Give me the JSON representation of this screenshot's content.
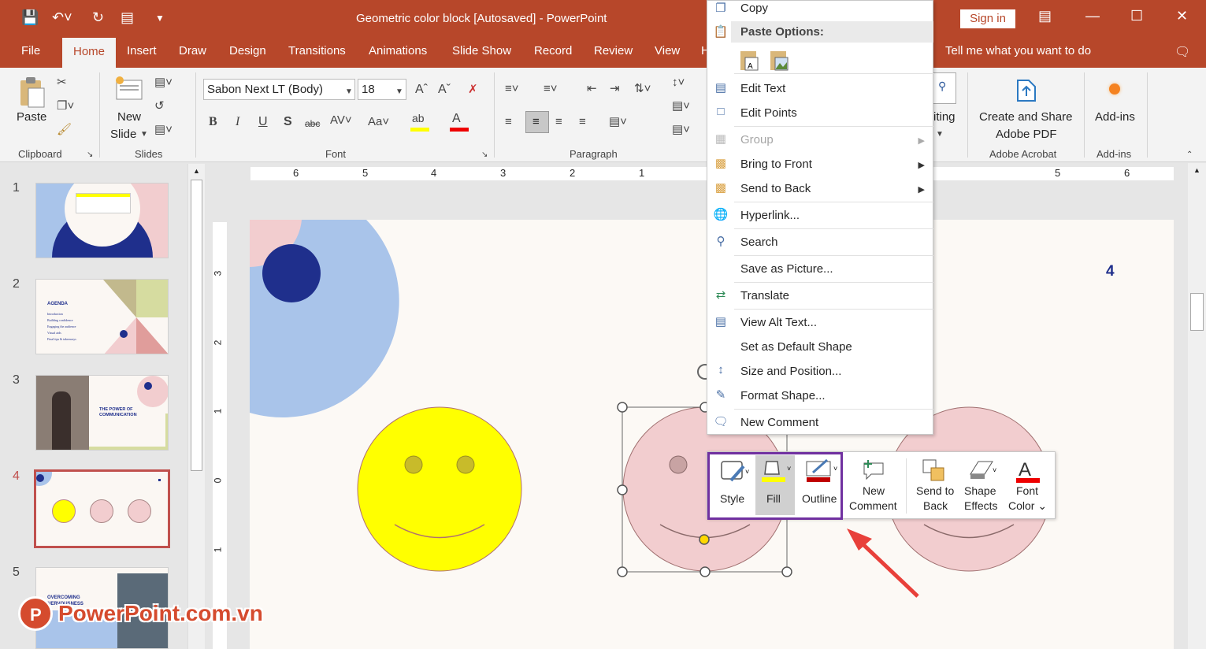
{
  "app": {
    "title": "Geometric color block [Autosaved]  -  PowerPoint",
    "sign_in": "Sign in",
    "tell_me": "Tell me what you want to do"
  },
  "tabs": [
    "File",
    "Home",
    "Insert",
    "Draw",
    "Design",
    "Transitions",
    "Animations",
    "Slide Show",
    "Record",
    "Review",
    "View",
    "H"
  ],
  "ribbon": {
    "clipboard": {
      "paste": "Paste",
      "label": "Clipboard"
    },
    "slides": {
      "new": "New",
      "slide": "Slide",
      "label": "Slides"
    },
    "font": {
      "name": "Sabon Next LT (Body)",
      "size": "18",
      "label": "Font"
    },
    "paragraph": {
      "label": "Paragraph"
    },
    "editing_partial": "iting",
    "acrobat": {
      "line1": "Create and Share",
      "line2": "Adobe PDF",
      "label": "Adobe Acrobat"
    },
    "addins": {
      "btn": "Add-ins",
      "label": "Add-ins"
    }
  },
  "slides": [
    {
      "num": "1"
    },
    {
      "num": "2",
      "heading": "AGENDA",
      "items": [
        "Introduction",
        "Building confidence",
        "Engaging the audience",
        "Visual aids",
        "Final tips & takeaways"
      ]
    },
    {
      "num": "3",
      "heading": "THE POWER OF COMMUNICATION"
    },
    {
      "num": "4"
    },
    {
      "num": "5",
      "heading": "OVERCOMING NERVOUSNESS"
    }
  ],
  "ruler": {
    "h": [
      "6",
      "5",
      "4",
      "3",
      "2",
      "1",
      "5",
      "6"
    ],
    "v": [
      "3",
      "2",
      "1",
      "0",
      "1"
    ]
  },
  "slide_number": "4",
  "context_menu": {
    "copy": "Copy",
    "paste_options": "Paste Options:",
    "edit_text": "Edit Text",
    "edit_points": "Edit Points",
    "group": "Group",
    "bring_front": "Bring to Front",
    "send_back": "Send to Back",
    "hyperlink": "Hyperlink...",
    "search": "Search",
    "save_picture": "Save as Picture...",
    "translate": "Translate",
    "alt_text": "View Alt Text...",
    "default_shape": "Set as Default Shape",
    "size_pos": "Size and Position...",
    "format_shape": "Format Shape...",
    "new_comment": "New Comment"
  },
  "mini_toolbar": {
    "style": "Style",
    "fill": "Fill",
    "outline": "Outline",
    "new": "New",
    "comment": "Comment",
    "send_to": "Send to",
    "back": "Back",
    "shape": "Shape",
    "effects": "Effects",
    "font": "Font",
    "color": "Color ⌄"
  },
  "watermark": "PowerPoint.com.vn",
  "colors": {
    "accent": "#b7472a",
    "selection": "#7030a0",
    "fill_yellow": "#ffff00",
    "outline_red": "#c00000"
  }
}
